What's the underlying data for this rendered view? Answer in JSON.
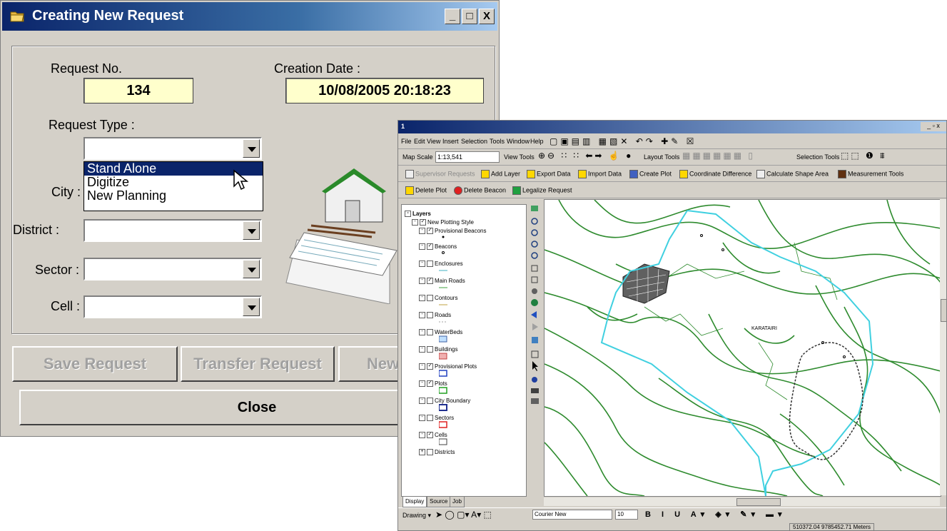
{
  "dialog": {
    "title": "Creating New Request",
    "request_no_label": "Request No.",
    "request_no_value": "134",
    "creation_date_label": "Creation Date :",
    "creation_date_value": "10/08/2005 20:18:23",
    "request_type_label": "Request Type :",
    "request_type_value": "",
    "request_type_options": [
      "Stand Alone",
      "Digitize",
      "New Planning"
    ],
    "request_type_highlighted": "Stand Alone",
    "city_label": "City :",
    "district_label": "District :",
    "sector_label": "Sector :",
    "cell_label": "Cell :",
    "buttons": {
      "save": "Save Request",
      "transfer": "Transfer Request",
      "new": "New",
      "close": "Close"
    },
    "title_buttons": {
      "minimize": "_",
      "maximize": "□",
      "close": "X"
    }
  },
  "gis": {
    "title": "1",
    "menu": [
      "File",
      "Edit",
      "View",
      "Insert",
      "Selection",
      "Tools",
      "Window",
      "Help"
    ],
    "map_scale_label": "Map Scale",
    "map_scale_value": "1:13,541",
    "toolbar_groups": [
      "View Tools",
      "Layout Tools",
      "Selection Tools"
    ],
    "toolbar2": [
      "Supervisor Requests",
      "Add Layer",
      "Export Data",
      "Import Data",
      "Create Plot",
      "Coordinate Difference",
      "Calculate Shape Area",
      "Measurement Tools"
    ],
    "toolbar3": [
      "Delete Plot",
      "Delete Beacon",
      "Legalize Request"
    ],
    "toc": {
      "root": "Layers",
      "group": "New Plotting Style",
      "layers": [
        {
          "name": "Provisional Beacons",
          "checked": true
        },
        {
          "name": "Beacons",
          "checked": true
        },
        {
          "name": "Enclosures",
          "checked": false
        },
        {
          "name": "Main Roads",
          "checked": true
        },
        {
          "name": "Contours",
          "checked": false
        },
        {
          "name": "Roads",
          "checked": false
        },
        {
          "name": "WaterBeds",
          "checked": false
        },
        {
          "name": "Buildings",
          "checked": false
        },
        {
          "name": "Provisional Plots",
          "checked": true
        },
        {
          "name": "Plots",
          "checked": true
        },
        {
          "name": "City Boundary",
          "checked": false
        },
        {
          "name": "Sectors",
          "checked": false
        },
        {
          "name": "Cells",
          "checked": true
        },
        {
          "name": "Districts",
          "checked": false
        }
      ]
    },
    "tabs": [
      "Display",
      "Source",
      "Job"
    ],
    "map_label": "KARATAIRI",
    "drawing_label": "Drawing",
    "font_name": "Courier New",
    "font_size": "10",
    "status_coords": "510372.04  9785452.71 Meters",
    "colors": {
      "roads": "#2e8b2e",
      "boundary": "#40d0e0"
    }
  }
}
